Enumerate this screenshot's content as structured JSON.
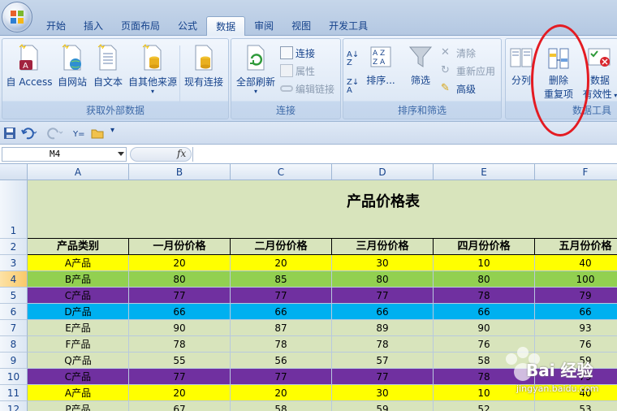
{
  "tabs": [
    "开始",
    "插入",
    "页面布局",
    "公式",
    "数据",
    "审阅",
    "视图",
    "开发工具"
  ],
  "active_tab": "数据",
  "ribbon": {
    "external": {
      "label": "获取外部数据",
      "access": "自 Access",
      "web": "自网站",
      "text": "自文本",
      "other": "自其他来源",
      "existing": "现有连接"
    },
    "connections": {
      "label": "连接",
      "refresh_all": "全部刷新",
      "connect": "连接",
      "properties": "属性",
      "edit_links": "编辑链接"
    },
    "sort_filter": {
      "label": "排序和筛选",
      "sort": "排序...",
      "filter": "筛选",
      "clear": "清除",
      "reapply": "重新应用",
      "advanced": "高级"
    },
    "data_tools": {
      "label": "数据工具",
      "split": "分列",
      "remove_dup_1": "删除",
      "remove_dup_2": "重复项",
      "validation_1": "数据",
      "validation_2": "有效性"
    }
  },
  "name_box": "M4",
  "fx": "fx",
  "columns": [
    "A",
    "B",
    "C",
    "D",
    "E",
    "F"
  ],
  "rows": [
    "1",
    "2",
    "3",
    "4",
    "5",
    "6",
    "7",
    "8",
    "9",
    "10",
    "11",
    "12"
  ],
  "selected_row": "4",
  "sheet_title": "产品价格表",
  "headers": [
    "产品类别",
    "一月份价格",
    "二月份价格",
    "三月份价格",
    "四月份价格",
    "五月份价格"
  ],
  "data_rows": [
    {
      "cells": [
        "A产品",
        "20",
        "20",
        "30",
        "10",
        "40"
      ],
      "color": "#ffff00"
    },
    {
      "cells": [
        "B产品",
        "80",
        "85",
        "80",
        "80",
        "100"
      ],
      "color": "#92d050"
    },
    {
      "cells": [
        "C产品",
        "77",
        "77",
        "77",
        "78",
        "79"
      ],
      "color": "#7030a0"
    },
    {
      "cells": [
        "D产品",
        "66",
        "66",
        "66",
        "66",
        "66"
      ],
      "color": "#00b0f0"
    },
    {
      "cells": [
        "E产品",
        "90",
        "87",
        "89",
        "90",
        "93"
      ],
      "color": "#d8e4bc"
    },
    {
      "cells": [
        "F产品",
        "78",
        "78",
        "78",
        "76",
        "76"
      ],
      "color": "#d8e4bc"
    },
    {
      "cells": [
        "Q产品",
        "55",
        "56",
        "57",
        "58",
        "59"
      ],
      "color": "#d8e4bc"
    },
    {
      "cells": [
        "C产品",
        "77",
        "77",
        "77",
        "78",
        "79"
      ],
      "color": "#7030a0"
    },
    {
      "cells": [
        "A产品",
        "20",
        "20",
        "30",
        "10",
        "40"
      ],
      "color": "#ffff00"
    },
    {
      "cells": [
        "P产品",
        "67",
        "58",
        "59",
        "52",
        "53"
      ],
      "color": "#d8e4bc"
    }
  ],
  "watermark": {
    "brand": "Bai 经验",
    "url": "jingyan.baidu.com"
  }
}
